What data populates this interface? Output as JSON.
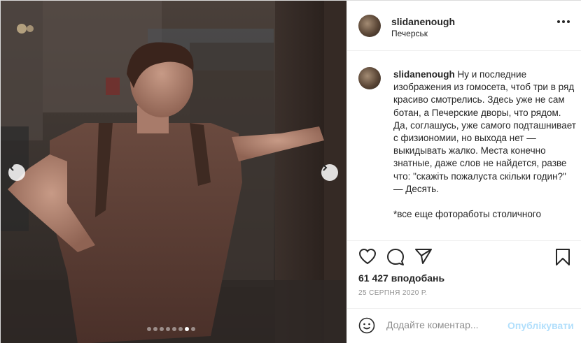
{
  "post": {
    "username": "slidanenough",
    "location": "Печерськ",
    "caption_user": "slidanenough",
    "caption_text": " Ну и последние изображения из гомосета, чтоб три в ряд красиво смотрелись. Здесь уже не сам ботан, а Печерские дворы, что рядом. Да, соглашусь, уже самого подташнивает с физиономии, но выхода нет — выкидывать жалко. Места конечно знатные, даже слов не найдется, разве что: \"скажіть пожалуста скільки годин?\"\n— Десять.\n\n*все еще фотоработы столичного",
    "likes": "61 427 вподобань",
    "date": "25 СЕРПНЯ 2020 Р."
  },
  "comment": {
    "placeholder": "Додайте коментар...",
    "post_label": "Опублікувати"
  },
  "carousel": {
    "total": 8,
    "active_index": 6
  },
  "icons": {
    "more": "more-options-icon",
    "like": "heart-icon",
    "comment": "comment-icon",
    "share": "share-icon",
    "save": "bookmark-icon",
    "emoji": "emoji-icon",
    "prev": "chevron-left-icon",
    "next": "chevron-right-icon"
  }
}
